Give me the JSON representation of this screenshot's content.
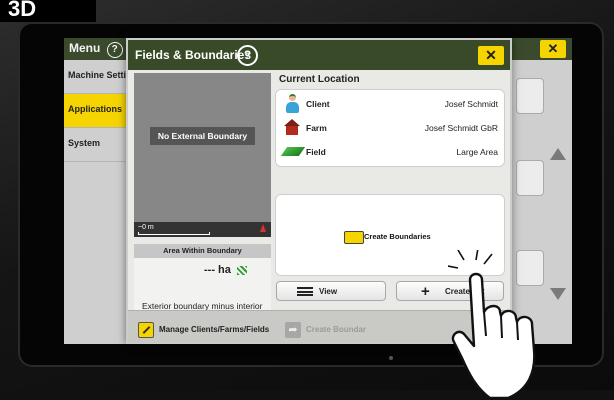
{
  "corner_tag": "3D",
  "background_app": {
    "menu_label": "Menu",
    "close_label": "✕",
    "sidebar_items": [
      {
        "label": "Machine Setti",
        "active": false
      },
      {
        "label": "Applications",
        "active": true
      },
      {
        "label": "System",
        "active": false
      }
    ]
  },
  "dialog": {
    "title": "Fields & Boundaries",
    "help_label": "?",
    "close_label": "✕",
    "map": {
      "placeholder": "No External Boundary",
      "scale_label": "~0 m"
    },
    "area": {
      "title": "Area Within Boundary",
      "value": "--- ha",
      "description": "Exterior boundary minus interior boundary areas."
    },
    "current_location": {
      "title": "Current Location",
      "rows": [
        {
          "label": "Client",
          "value": "Josef Schmidt",
          "icon": "client-person-icon"
        },
        {
          "label": "Farm",
          "value": "Josef Schmidt GbR",
          "icon": "farm-barn-icon"
        },
        {
          "label": "Field",
          "value": "Large Area",
          "icon": "field-icon"
        }
      ]
    },
    "create_boundaries_label": "Create Boundaries",
    "view_button": "View",
    "create_set_button": "Create Set",
    "footer": {
      "manage_label": "Manage Clients/Farms/Fields",
      "create_boundary_label": "Create Boundar"
    }
  },
  "colors": {
    "header_green": "#384a27",
    "accent_yellow": "#f5d400"
  }
}
